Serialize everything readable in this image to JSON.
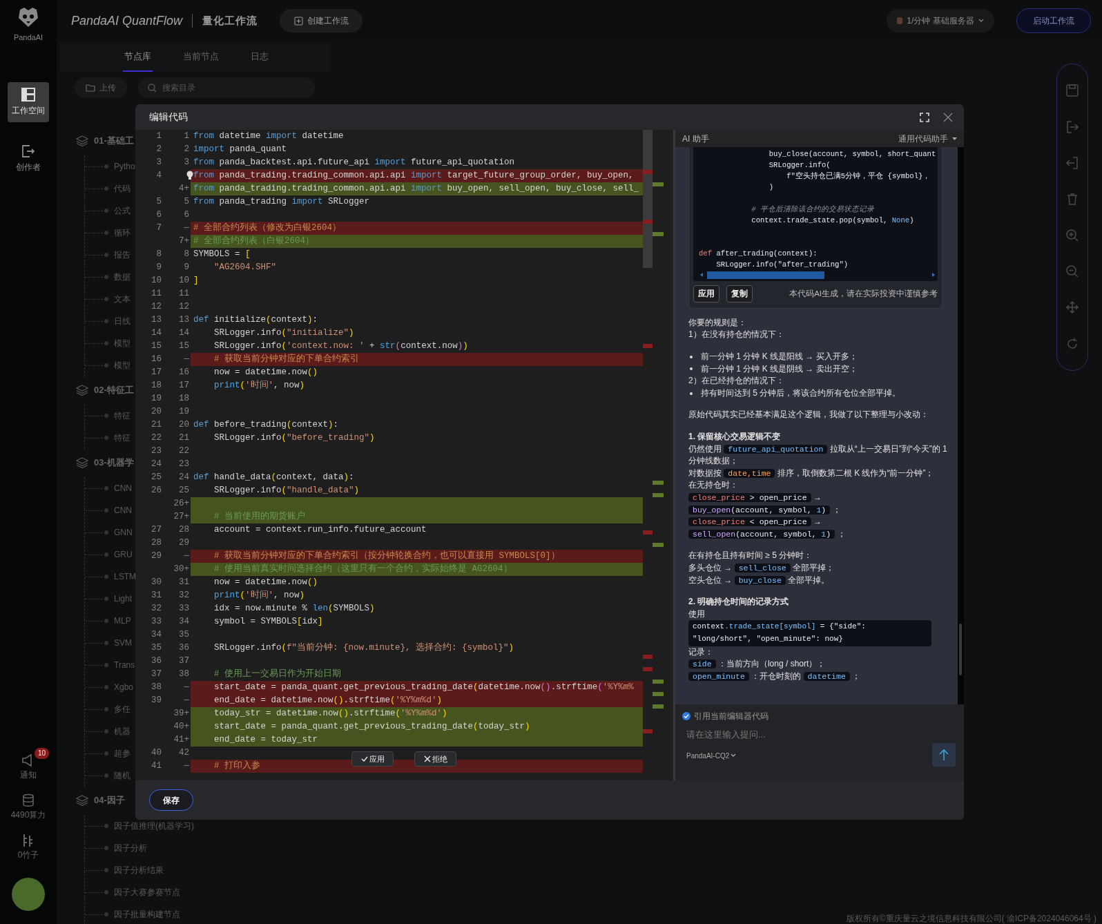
{
  "app": {
    "brand": "PandaAI",
    "title": "PandaAI QuantFlow",
    "subtitle": "量化工作流",
    "create_button": "创建工作流",
    "server": {
      "rate": "1/分钟",
      "name": "基础服务器"
    },
    "start_button": "启动工作流"
  },
  "nav": {
    "items": [
      {
        "kind": "workspace",
        "label": "工作空间",
        "selected": true
      },
      {
        "kind": "creator",
        "label": "创作者",
        "selected": false
      }
    ],
    "bottom": [
      {
        "kind": "notice",
        "label": "通知",
        "badge": "10"
      },
      {
        "kind": "compute",
        "label": "4490算力"
      },
      {
        "kind": "bamboo",
        "label": "0竹子"
      }
    ]
  },
  "library": {
    "tabs": [
      {
        "label": "节点库",
        "selected": true
      },
      {
        "label": "当前节点",
        "selected": false
      },
      {
        "label": "日志",
        "selected": false
      }
    ],
    "upload_button": "上传",
    "search": {
      "placeholder": "搜索目录"
    },
    "groups": [
      {
        "title": "01-基础工",
        "children": [
          {
            "label": "Pytho"
          },
          {
            "label": "代码"
          },
          {
            "label": "公式"
          },
          {
            "label": "循环"
          },
          {
            "label": "报告"
          },
          {
            "label": "数据"
          },
          {
            "label": "文本"
          },
          {
            "label": "日线"
          },
          {
            "label": "模型"
          },
          {
            "label": "模型"
          }
        ]
      },
      {
        "title": "02-特征工",
        "children": [
          {
            "label": "特征"
          },
          {
            "label": "特征"
          }
        ]
      },
      {
        "title": "03-机器学",
        "children": [
          {
            "label": "CNN"
          },
          {
            "label": "CNN"
          },
          {
            "label": "GNN"
          },
          {
            "label": "GRU"
          },
          {
            "label": "LSTM"
          },
          {
            "label": "Light"
          },
          {
            "label": "MLP"
          },
          {
            "label": "SVM"
          },
          {
            "label": "Trans"
          },
          {
            "label": "Xgbo"
          },
          {
            "label": "多任"
          },
          {
            "label": "机器"
          },
          {
            "label": "超参"
          },
          {
            "label": "随机"
          }
        ]
      },
      {
        "title": "04-因子",
        "children": [
          {
            "label": "因子值推理(机器学习)"
          },
          {
            "label": "因子分析"
          },
          {
            "label": "因子分析结果"
          },
          {
            "label": "因子大赛参赛节点"
          },
          {
            "label": "因子批量构建节点"
          }
        ]
      }
    ]
  },
  "editor": {
    "title": "编辑代码",
    "rows": [
      {
        "old": "1",
        "new": "1",
        "kind": "context",
        "tokens": [
          {
            "kind": "kw",
            "text": "from"
          },
          {
            "kind": "plain",
            "text": " datetime "
          },
          {
            "kind": "kw",
            "text": "import"
          },
          {
            "kind": "plain",
            "text": " datetime"
          }
        ]
      },
      {
        "old": "2",
        "new": "2",
        "kind": "context",
        "tokens": [
          {
            "kind": "kw",
            "text": "import"
          },
          {
            "kind": "plain",
            "text": " panda_quant"
          }
        ]
      },
      {
        "old": "3",
        "new": "3",
        "kind": "context",
        "tokens": [
          {
            "kind": "kw",
            "text": "from"
          },
          {
            "kind": "plain",
            "text": " panda_backtest.api.future_api "
          },
          {
            "kind": "kw",
            "text": "import"
          },
          {
            "kind": "plain",
            "text": " future_api_quotation"
          }
        ]
      },
      {
        "old": "4",
        "kind": "removed",
        "tokens": [
          {
            "kind": "kw",
            "text": "from"
          },
          {
            "kind": "plain",
            "text": " panda_trading.trading_common.api.api "
          },
          {
            "kind": "kw",
            "text": "import"
          },
          {
            "kind": "plain",
            "text": " target_future_group_order, buy_open,"
          }
        ]
      },
      {
        "new": "4+",
        "kind": "added",
        "tokens": [
          {
            "kind": "kw",
            "text": "from"
          },
          {
            "kind": "plain",
            "text": " panda_trading.trading_common.api.api "
          },
          {
            "kind": "kw",
            "text": "import"
          },
          {
            "kind": "plain",
            "text": " buy_open, sell_open, buy_close, sell_"
          }
        ]
      },
      {
        "old": "5",
        "new": "5",
        "kind": "context",
        "tokens": [
          {
            "kind": "kw",
            "text": "from"
          },
          {
            "kind": "plain",
            "text": " panda_trading "
          },
          {
            "kind": "kw",
            "text": "import"
          },
          {
            "kind": "plain",
            "text": " SRLogger"
          }
        ]
      },
      {
        "old": "6",
        "new": "6",
        "kind": "context"
      },
      {
        "old": "7",
        "marker": "—",
        "kind": "removed",
        "tokens": [
          {
            "kind": "com",
            "text": "# 全部合约列表（修改为白银2604）"
          }
        ]
      },
      {
        "new": "7+",
        "kind": "added",
        "tokens": [
          {
            "kind": "com",
            "text": "# 全部合约列表（白银2604）"
          }
        ]
      },
      {
        "old": "8",
        "new": "8",
        "kind": "context",
        "tokens": [
          {
            "kind": "plain",
            "text": "SYMBOLS = "
          },
          {
            "kind": "br",
            "text": "["
          }
        ]
      },
      {
        "old": "9",
        "new": "9",
        "kind": "context",
        "tokens": [
          {
            "kind": "str",
            "text": "    \"AG2604.SHF\""
          }
        ]
      },
      {
        "old": "10",
        "new": "10",
        "kind": "context",
        "tokens": [
          {
            "kind": "br",
            "text": "]"
          }
        ]
      },
      {
        "old": "11",
        "new": "11",
        "kind": "context"
      },
      {
        "old": "12",
        "new": "12",
        "kind": "context"
      },
      {
        "old": "13",
        "new": "13",
        "kind": "context",
        "tokens": [
          {
            "kind": "kw",
            "text": "def"
          },
          {
            "kind": "plain",
            "text": " initialize"
          },
          {
            "kind": "br",
            "text": "("
          },
          {
            "kind": "plain",
            "text": "context"
          },
          {
            "kind": "br",
            "text": ")"
          },
          {
            "kind": "plain",
            "text": ":"
          }
        ]
      },
      {
        "old": "14",
        "new": "14",
        "kind": "context",
        "tokens": [
          {
            "kind": "plain",
            "text": "    SRLogger.info"
          },
          {
            "kind": "br",
            "text": "("
          },
          {
            "kind": "str",
            "text": "\"initialize\""
          },
          {
            "kind": "br",
            "text": ")"
          }
        ]
      },
      {
        "old": "15",
        "new": "15",
        "kind": "context",
        "tokens": [
          {
            "kind": "plain",
            "text": "    SRLogger.info"
          },
          {
            "kind": "br",
            "text": "("
          },
          {
            "kind": "str",
            "text": "'context.now: '"
          },
          {
            "kind": "plain",
            "text": " + "
          },
          {
            "kind": "builtin",
            "text": "str"
          },
          {
            "kind": "br2",
            "text": "("
          },
          {
            "kind": "plain",
            "text": "context.now"
          },
          {
            "kind": "br2",
            "text": ")"
          },
          {
            "kind": "br",
            "text": ")"
          }
        ]
      },
      {
        "old": "16",
        "marker": "—",
        "kind": "removed",
        "tokens": [
          {
            "kind": "com",
            "text": "    # 获取当前分钟对应的下单合约索引"
          }
        ]
      },
      {
        "old": "17",
        "new": "16",
        "kind": "context",
        "tokens": [
          {
            "kind": "plain",
            "text": "    now = datetime.now"
          },
          {
            "kind": "br",
            "text": "()"
          }
        ]
      },
      {
        "old": "18",
        "new": "17",
        "kind": "context",
        "tokens": [
          {
            "kind": "builtin",
            "text": "    print"
          },
          {
            "kind": "br",
            "text": "("
          },
          {
            "kind": "str",
            "text": "'时间'"
          },
          {
            "kind": "plain",
            "text": ", now"
          },
          {
            "kind": "br",
            "text": ")"
          }
        ]
      },
      {
        "old": "19",
        "new": "18",
        "kind": "context"
      },
      {
        "old": "20",
        "new": "19",
        "kind": "context"
      },
      {
        "old": "21",
        "new": "20",
        "kind": "context",
        "tokens": [
          {
            "kind": "kw",
            "text": "def"
          },
          {
            "kind": "plain",
            "text": " before_trading"
          },
          {
            "kind": "br",
            "text": "("
          },
          {
            "kind": "plain",
            "text": "context"
          },
          {
            "kind": "br",
            "text": ")"
          },
          {
            "kind": "plain",
            "text": ":"
          }
        ]
      },
      {
        "old": "22",
        "new": "21",
        "kind": "context",
        "tokens": [
          {
            "kind": "plain",
            "text": "    SRLogger.info"
          },
          {
            "kind": "br",
            "text": "("
          },
          {
            "kind": "str",
            "text": "\"before_trading\""
          },
          {
            "kind": "br",
            "text": ")"
          }
        ]
      },
      {
        "old": "23",
        "new": "22",
        "kind": "context"
      },
      {
        "old": "24",
        "new": "23",
        "kind": "context"
      },
      {
        "old": "25",
        "new": "24",
        "kind": "context",
        "tokens": [
          {
            "kind": "kw",
            "text": "def"
          },
          {
            "kind": "plain",
            "text": " handle_data"
          },
          {
            "kind": "br",
            "text": "("
          },
          {
            "kind": "plain",
            "text": "context, data"
          },
          {
            "kind": "br",
            "text": ")"
          },
          {
            "kind": "plain",
            "text": ":"
          }
        ]
      },
      {
        "old": "26",
        "new": "25",
        "kind": "context",
        "tokens": [
          {
            "kind": "plain",
            "text": "    SRLogger.info"
          },
          {
            "kind": "br",
            "text": "("
          },
          {
            "kind": "str",
            "text": "\"handle_data\""
          },
          {
            "kind": "br",
            "text": ")"
          }
        ]
      },
      {
        "new": "26+",
        "kind": "added"
      },
      {
        "new": "27+",
        "kind": "added",
        "tokens": [
          {
            "kind": "com",
            "text": "    # 当前使用的期货账户"
          }
        ]
      },
      {
        "old": "27",
        "new": "28",
        "kind": "context",
        "tokens": [
          {
            "kind": "plain",
            "text": "    account = context.run_info.future_account"
          }
        ]
      },
      {
        "old": "28",
        "new": "29",
        "kind": "context"
      },
      {
        "old": "29",
        "marker": "—",
        "kind": "removed",
        "tokens": [
          {
            "kind": "com",
            "text": "    # 获取当前分钟对应的下单合约索引（按分钟轮换合约，也可以直接用 SYMBOLS[0]）"
          }
        ]
      },
      {
        "new": "30+",
        "kind": "added",
        "tokens": [
          {
            "kind": "com",
            "text": "    # 使用当前真实时间选择合约（这里只有一个合约，实际始终是 AG2604）"
          }
        ]
      },
      {
        "old": "30",
        "new": "31",
        "kind": "context",
        "tokens": [
          {
            "kind": "plain",
            "text": "    now = datetime.now"
          },
          {
            "kind": "br",
            "text": "()"
          }
        ]
      },
      {
        "old": "31",
        "new": "32",
        "kind": "context",
        "tokens": [
          {
            "kind": "builtin",
            "text": "    print"
          },
          {
            "kind": "br",
            "text": "("
          },
          {
            "kind": "str",
            "text": "'时间'"
          },
          {
            "kind": "plain",
            "text": ", now"
          },
          {
            "kind": "br",
            "text": ")"
          }
        ]
      },
      {
        "old": "32",
        "new": "33",
        "kind": "context",
        "tokens": [
          {
            "kind": "plain",
            "text": "    idx = now.minute % "
          },
          {
            "kind": "builtin",
            "text": "len"
          },
          {
            "kind": "br",
            "text": "("
          },
          {
            "kind": "plain",
            "text": "SYMBOLS"
          },
          {
            "kind": "br",
            "text": ")"
          }
        ]
      },
      {
        "old": "33",
        "new": "34",
        "kind": "context",
        "tokens": [
          {
            "kind": "plain",
            "text": "    symbol = SYMBOLS"
          },
          {
            "kind": "br",
            "text": "["
          },
          {
            "kind": "plain",
            "text": "idx"
          },
          {
            "kind": "br",
            "text": "]"
          }
        ]
      },
      {
        "old": "34",
        "new": "35",
        "kind": "context"
      },
      {
        "old": "35",
        "new": "36",
        "kind": "context",
        "tokens": [
          {
            "kind": "plain",
            "text": "    SRLogger.info"
          },
          {
            "kind": "br",
            "text": "("
          },
          {
            "kind": "str",
            "text": "f\"当前分钟: {now.minute}, 选择合约: {symbol}\""
          },
          {
            "kind": "br",
            "text": ")"
          }
        ]
      },
      {
        "old": "36",
        "new": "37",
        "kind": "context"
      },
      {
        "old": "37",
        "new": "38",
        "kind": "context",
        "tokens": [
          {
            "kind": "com",
            "text": "    # 使用上一交易日作为开始日期"
          }
        ]
      },
      {
        "old": "38",
        "marker": "—",
        "kind": "removed",
        "tokens": [
          {
            "kind": "plain",
            "text": "    start_date = panda_quant.get_previous_trading_date"
          },
          {
            "kind": "br",
            "text": "("
          },
          {
            "kind": "plain",
            "text": "datetime.now"
          },
          {
            "kind": "br2",
            "text": "()"
          },
          {
            "kind": "plain",
            "text": ".strftime"
          },
          {
            "kind": "br2",
            "text": "("
          },
          {
            "kind": "str",
            "text": "'%Y%m%"
          }
        ]
      },
      {
        "old": "39",
        "marker": "—",
        "kind": "removed",
        "tokens": [
          {
            "kind": "plain",
            "text": "    end_date = datetime.now"
          },
          {
            "kind": "br",
            "text": "()"
          },
          {
            "kind": "plain",
            "text": ".strftime"
          },
          {
            "kind": "br",
            "text": "("
          },
          {
            "kind": "str",
            "text": "'%Y%m%d'"
          },
          {
            "kind": "br",
            "text": ")"
          }
        ]
      },
      {
        "new": "39+",
        "kind": "added",
        "tokens": [
          {
            "kind": "plain",
            "text": "    today_str = datetime.now"
          },
          {
            "kind": "br",
            "text": "()"
          },
          {
            "kind": "plain",
            "text": ".strftime"
          },
          {
            "kind": "br",
            "text": "("
          },
          {
            "kind": "str",
            "text": "'%Y%m%d'"
          },
          {
            "kind": "br",
            "text": ")"
          }
        ]
      },
      {
        "new": "40+",
        "kind": "added",
        "tokens": [
          {
            "kind": "plain",
            "text": "    start_date = panda_quant.get_previous_trading_date"
          },
          {
            "kind": "br",
            "text": "("
          },
          {
            "kind": "plain",
            "text": "today_str"
          },
          {
            "kind": "br",
            "text": ")"
          }
        ]
      },
      {
        "new": "41+",
        "kind": "added",
        "tokens": [
          {
            "kind": "plain",
            "text": "    end_date = today_str"
          }
        ]
      },
      {
        "old": "40",
        "new": "42",
        "kind": "context"
      },
      {
        "old": "41",
        "marker": "—",
        "kind": "removed",
        "tokens": [
          {
            "kind": "com",
            "text": "    # 打印入参"
          }
        ]
      }
    ],
    "inline_actions": [
      {
        "kind": "accept",
        "label": "应用"
      },
      {
        "kind": "reject",
        "label": "拒绝"
      }
    ],
    "save_button": "保存"
  },
  "assistant": {
    "title": "AI 助手",
    "mode": "通用代码助手",
    "snippet": {
      "lines": [
        {
          "kind": "code",
          "tokens": [
            {
              "kind": "text",
              "text": "                buy_close(account, symbol, short_quant"
            }
          ]
        },
        {
          "kind": "code",
          "tokens": [
            {
              "kind": "text",
              "text": "                SRLogger.info("
            }
          ]
        },
        {
          "kind": "code",
          "tokens": [
            {
              "kind": "text",
              "text": "                    f\"空头持仓已满5分钟，平仓 {symbol}，"
            }
          ]
        },
        {
          "kind": "code",
          "tokens": [
            {
              "kind": "text",
              "text": "                )"
            }
          ]
        },
        {
          "kind": "blank"
        },
        {
          "kind": "code",
          "tokens": [
            {
              "kind": "comment",
              "text": "            # 平仓后清除该合约的交易状态记录"
            }
          ]
        },
        {
          "kind": "code",
          "tokens": [
            {
              "kind": "text",
              "text": "            context.trade_state.pop(symbol, "
            },
            {
              "kind": "name",
              "text": "None"
            },
            {
              "kind": "text",
              "text": ")"
            }
          ]
        },
        {
          "kind": "blank"
        },
        {
          "kind": "blank"
        },
        {
          "kind": "code",
          "tokens": [
            {
              "kind": "keyword",
              "text": "def"
            },
            {
              "kind": "text",
              "text": " after_trading(context):"
            }
          ]
        },
        {
          "kind": "code",
          "tokens": [
            {
              "kind": "text",
              "text": "    SRLogger.info(\"after_trading\")"
            }
          ]
        }
      ],
      "apply_button": "应用",
      "copy_button": "复制",
      "note": "本代码AI生成，请在实际投资中谨慎参考"
    },
    "answer": [
      {
        "lines": [
          {
            "kind": "text",
            "parts": [
              {
                "kind": "text",
                "text": "你要的规则是："
              }
            ]
          },
          {
            "kind": "text",
            "parts": [
              {
                "kind": "text",
                "text": "1）在没有持仓的情况下："
              }
            ]
          }
        ]
      },
      {
        "lines": [
          {
            "kind": "bullet",
            "parts": [
              {
                "kind": "text",
                "text": "前一分钟 1 分钟 K 线是阳线 → 买入开多；"
              }
            ]
          },
          {
            "kind": "bullet",
            "parts": [
              {
                "kind": "text",
                "text": "前一分钟 1 分钟 K 线是阴线 → 卖出开空；"
              }
            ]
          },
          {
            "kind": "text",
            "parts": [
              {
                "kind": "text",
                "text": "2）在已经持仓的情况下："
              }
            ]
          },
          {
            "kind": "bullet",
            "parts": [
              {
                "kind": "text",
                "text": "持有时间达到 5 分钟后，将该合约所有仓位全部平掉。"
              }
            ]
          }
        ]
      },
      {
        "lines": [
          {
            "kind": "text",
            "parts": [
              {
                "kind": "text",
                "text": "原始代码其实已经基本满足这个逻辑，我做了以下整理与小改动："
              }
            ]
          }
        ]
      },
      {
        "lines": [
          {
            "kind": "heading",
            "parts": [
              {
                "kind": "text",
                "text": "1. 保留核心交易逻辑不变"
              }
            ]
          },
          {
            "kind": "text",
            "parts": [
              {
                "kind": "text",
                "text": "仍然使用 "
              },
              {
                "kind": "code",
                "tokens": [
                  {
                    "kind": "name",
                    "text": "future_api_quotation"
                  }
                ]
              },
              {
                "kind": "text",
                "text": " 拉取从“上一交易日”到“今天”的 1 分钟线数据；"
              }
            ]
          },
          {
            "kind": "text",
            "parts": [
              {
                "kind": "text",
                "text": "对数据按 "
              },
              {
                "kind": "code",
                "tokens": [
                  {
                    "kind": "const",
                    "text": "date,time"
                  }
                ]
              },
              {
                "kind": "text",
                "text": " 排序，取倒数第二根 K 线作为“前一分钟”；"
              }
            ]
          },
          {
            "kind": "text",
            "parts": [
              {
                "kind": "text",
                "text": "在无持仓时："
              }
            ]
          },
          {
            "kind": "text",
            "parts": [
              {
                "kind": "code",
                "tokens": [
                  {
                    "kind": "keyword",
                    "text": "close_price"
                  },
                  {
                    "kind": "text",
                    "text": " > open_price"
                  }
                ]
              },
              {
                "kind": "text",
                "text": " →"
              }
            ]
          },
          {
            "kind": "text",
            "parts": [
              {
                "kind": "code",
                "tokens": [
                  {
                    "kind": "func",
                    "text": "buy_open"
                  },
                  {
                    "kind": "text",
                    "text": "(account, symbol, "
                  },
                  {
                    "kind": "name",
                    "text": "1"
                  },
                  {
                    "kind": "text",
                    "text": ")"
                  }
                ]
              },
              {
                "kind": "text",
                "text": " ；"
              }
            ]
          },
          {
            "kind": "text",
            "parts": [
              {
                "kind": "code",
                "tokens": [
                  {
                    "kind": "keyword",
                    "text": "close_price"
                  },
                  {
                    "kind": "text",
                    "text": " < open_price"
                  }
                ]
              },
              {
                "kind": "text",
                "text": " →"
              }
            ]
          },
          {
            "kind": "text",
            "parts": [
              {
                "kind": "code",
                "tokens": [
                  {
                    "kind": "func",
                    "text": "sell_open"
                  },
                  {
                    "kind": "text",
                    "text": "(account, symbol, "
                  },
                  {
                    "kind": "name",
                    "text": "1"
                  },
                  {
                    "kind": "text",
                    "text": ")"
                  }
                ]
              },
              {
                "kind": "text",
                "text": " ；"
              }
            ]
          }
        ]
      },
      {
        "lines": [
          {
            "kind": "text",
            "parts": [
              {
                "kind": "text",
                "text": "在有持仓且持有时间 ≥ 5 分钟时："
              }
            ]
          },
          {
            "kind": "text",
            "parts": [
              {
                "kind": "text",
                "text": "多头仓位 → "
              },
              {
                "kind": "code",
                "tokens": [
                  {
                    "kind": "name",
                    "text": "sell_close"
                  }
                ]
              },
              {
                "kind": "text",
                "text": " 全部平掉；"
              }
            ]
          },
          {
            "kind": "text",
            "parts": [
              {
                "kind": "text",
                "text": "空头仓位 → "
              },
              {
                "kind": "code",
                "tokens": [
                  {
                    "kind": "name",
                    "text": "buy_close"
                  }
                ]
              },
              {
                "kind": "text",
                "text": " 全部平掉。"
              }
            ]
          }
        ]
      },
      {
        "lines": [
          {
            "kind": "heading",
            "parts": [
              {
                "kind": "text",
                "text": "2. 明确持仓时间的记录方式"
              }
            ]
          },
          {
            "kind": "text",
            "parts": [
              {
                "kind": "text",
                "text": "使用"
              }
            ]
          },
          {
            "kind": "code_block",
            "tokens": [
              {
                "kind": "text",
                "text": "context"
              },
              {
                "kind": "name",
                "text": ".trade_state[symbol]"
              },
              {
                "kind": "text",
                "text": " = {\"side\": \"long/short\", \"open_minute\": now}"
              }
            ]
          },
          {
            "kind": "text",
            "parts": [
              {
                "kind": "text",
                "text": "记录："
              }
            ]
          },
          {
            "kind": "text",
            "parts": [
              {
                "kind": "code",
                "tokens": [
                  {
                    "kind": "name",
                    "text": "side"
                  }
                ]
              },
              {
                "kind": "text",
                "text": " ：当前方向（long / short）；"
              }
            ]
          },
          {
            "kind": "text",
            "parts": [
              {
                "kind": "code",
                "tokens": [
                  {
                    "kind": "name",
                    "text": "open_minute"
                  }
                ]
              },
              {
                "kind": "text",
                "text": " ：开仓时刻的 "
              },
              {
                "kind": "code",
                "tokens": [
                  {
                    "kind": "name",
                    "text": "datetime"
                  }
                ]
              },
              {
                "kind": "text",
                "text": " ；"
              }
            ]
          }
        ]
      }
    ],
    "quote_editor": {
      "label": "引用当前编辑器代码",
      "checked": true
    },
    "prompt": {
      "placeholder": "请在这里输入提问..."
    },
    "model": "PandaAI-CQ2"
  },
  "footer": "版权所有©重庆量云之境信息科技有限公司( 渝ICP备2024046064号 )"
}
